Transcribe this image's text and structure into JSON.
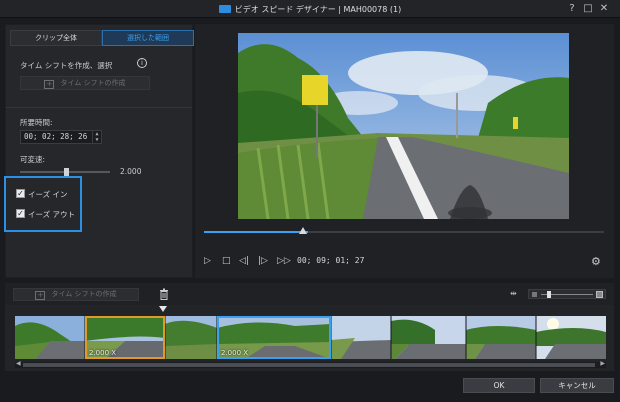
{
  "window": {
    "title": "ビデオ スピード デザイナー | MAH00078 (1)",
    "help": "?",
    "maximize": "□",
    "close": "✕"
  },
  "left_panel": {
    "tabs": [
      {
        "label": "クリップ全体",
        "active": false
      },
      {
        "label": "選択した範囲",
        "active": true
      }
    ],
    "timeshift_heading": "タイム シフトを作成、選択",
    "info": "i",
    "create_timeshift_button": "タイム シフトの作成",
    "duration_label": "所要時間:",
    "duration_value": "00; 02; 28; 26",
    "variable_speed_label": "可変速:",
    "speed_value": "2.000",
    "ease_in_label": "イーズ イン",
    "ease_in_checked": true,
    "ease_out_label": "イーズ アウト",
    "ease_out_checked": true
  },
  "preview": {
    "seek_progress": 0.26,
    "timecode": "00; 09; 01; 27",
    "controls": [
      "play",
      "stop",
      "prev-frame",
      "next-frame",
      "fast-forward"
    ]
  },
  "timeline": {
    "create_timeshift_button": "タイム シフトの作成",
    "selections": [
      {
        "speed": "2.000 X",
        "color": "#e09a25"
      },
      {
        "speed": "2.000 X",
        "color": "#3aa0f0"
      }
    ]
  },
  "footer": {
    "ok": "OK",
    "cancel": "キャンセル"
  },
  "colors": {
    "accent": "#3aa0f0",
    "selection_orange": "#e09a25",
    "background": "#1a1b1e"
  }
}
